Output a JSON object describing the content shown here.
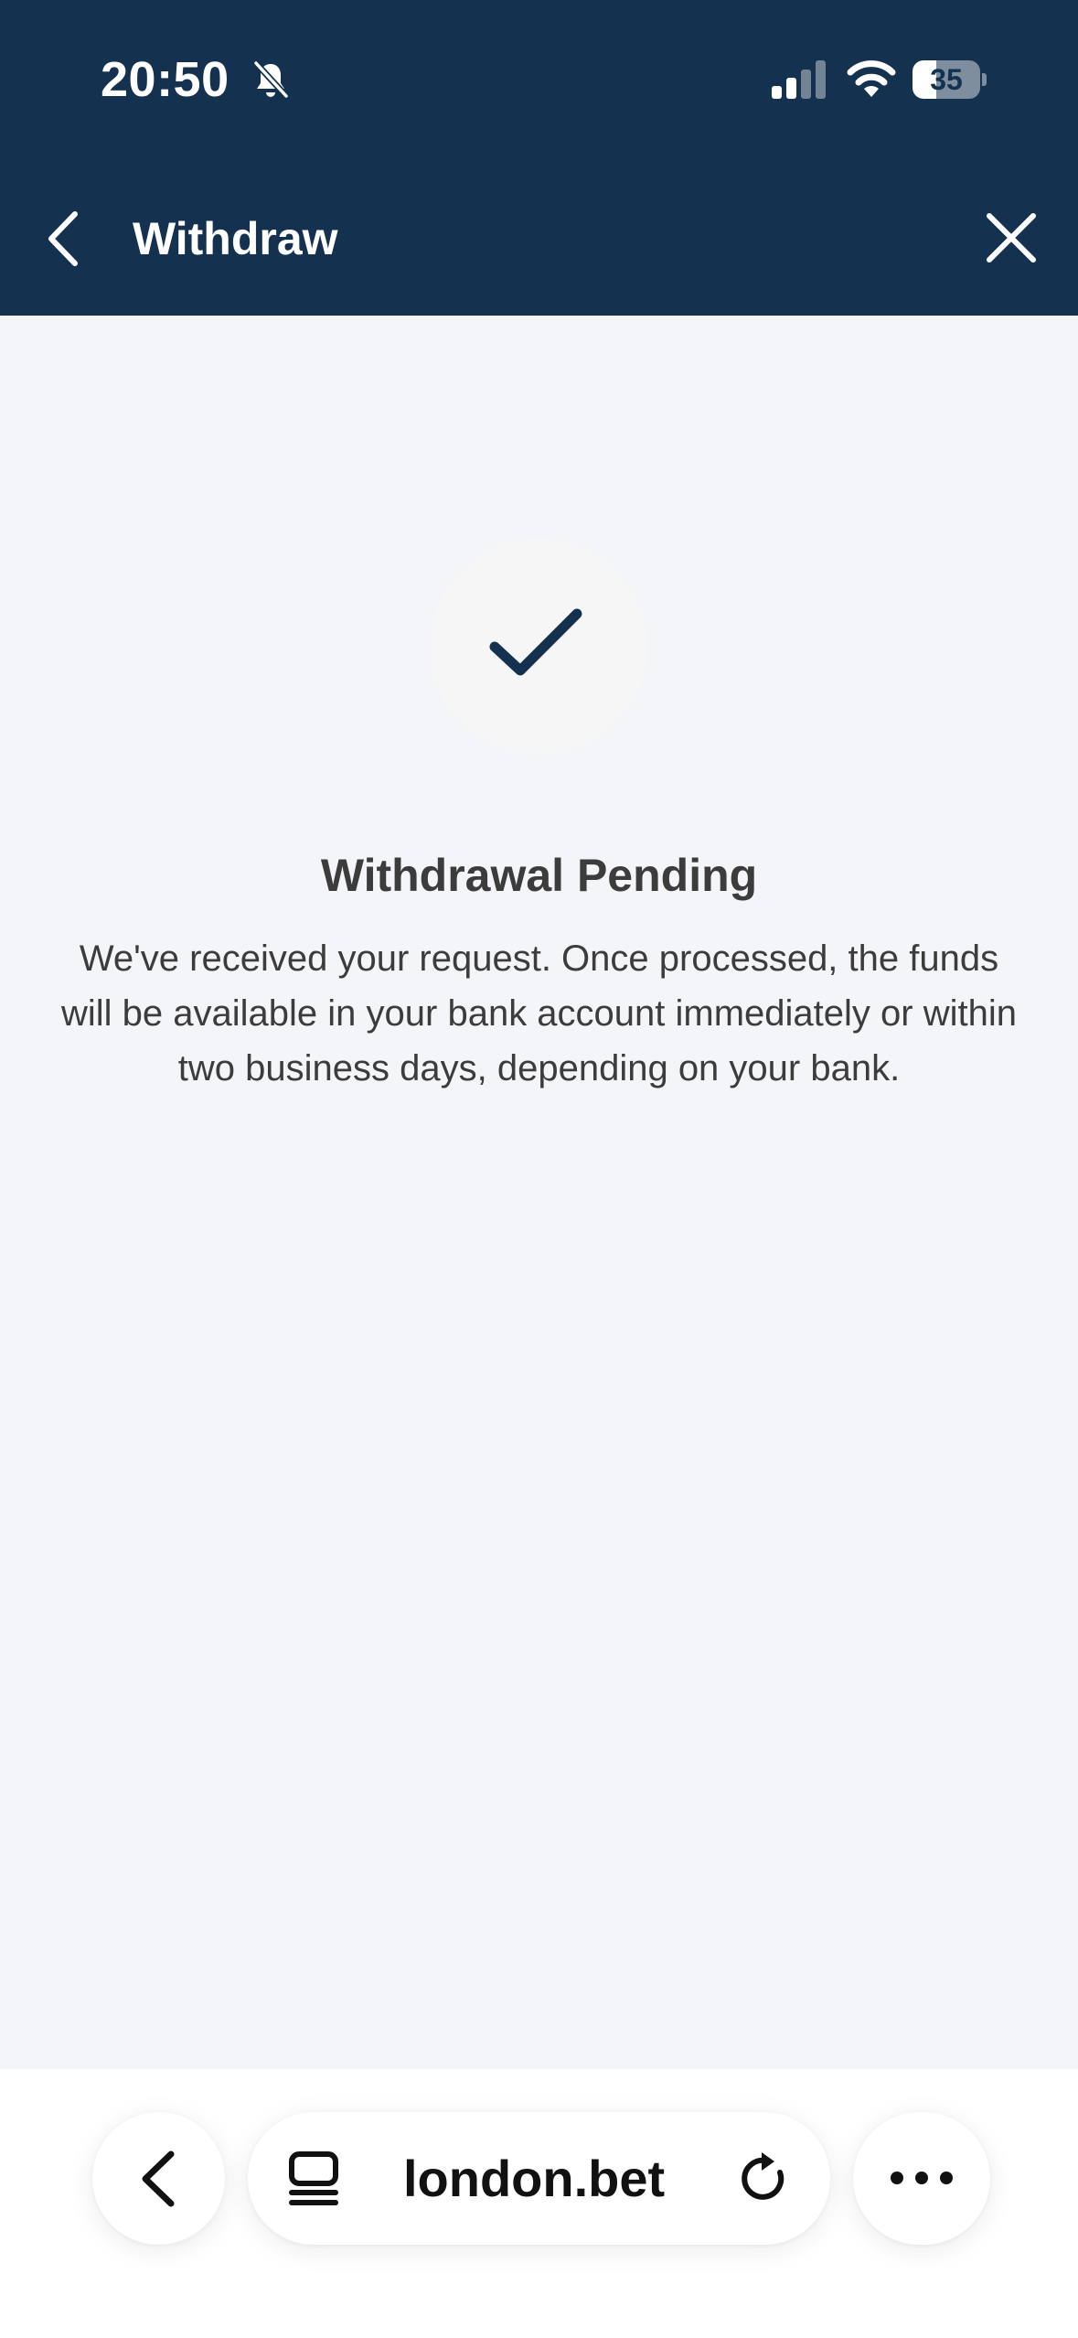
{
  "status_bar": {
    "time": "20:50",
    "battery_level": 35,
    "battery_text": "35",
    "icons": [
      "bell-slash-icon",
      "signal-icon",
      "wifi-icon",
      "battery-icon"
    ]
  },
  "nav": {
    "title": "Withdraw",
    "back_icon": "chevron-left-icon",
    "close_icon": "close-icon"
  },
  "content": {
    "icon": "checkmark-icon",
    "title": "Withdrawal Pending",
    "message": "We've received your request. Once processed, the funds will be available in your bank account immediately or within two business days, depending on your bank."
  },
  "browser_bar": {
    "url": "london.bet",
    "icons": [
      "chevron-left-icon",
      "tabs-icon",
      "reload-icon",
      "more-icon"
    ]
  },
  "colors": {
    "header_bg": "#14324f",
    "page_bg": "#f4f5f8",
    "text": "#3c3c3c",
    "check": "#14324f"
  }
}
